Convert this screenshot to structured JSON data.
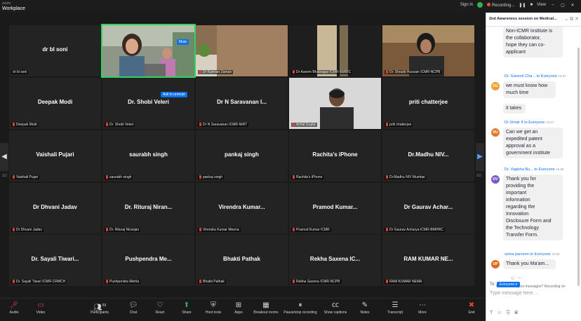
{
  "titlebar": {
    "brand_small": "zoom",
    "brand_big": "Workplace",
    "signin": "Sign in",
    "recording": "Recording...",
    "view": "View",
    "pause_icon": "pause-icon",
    "stop_icon": "stop-icon",
    "minimize_icon": "minimize-icon",
    "maximize_icon": "maximize-icon",
    "close_icon": "close-icon"
  },
  "meeting": {
    "mute_label": "Mute",
    "ask_unmute": "Ask to unmute",
    "page_left": "1/2",
    "page_right": "1/2",
    "tiles": [
      {
        "name": "dr bl soni",
        "label": "dr bl soni",
        "video": false
      },
      {
        "name": "",
        "label": "",
        "video": true
      },
      {
        "name": "",
        "label": "Dr Kamran Zaman",
        "video": true
      },
      {
        "name": "",
        "label": "Dr Aseem Bhatnagar ICMR-BMIRC",
        "video": true
      },
      {
        "name": "",
        "label": "Dr. Shoaib Hussain ICMR-NCPB",
        "video": true
      },
      {
        "name": "Deepak Modi",
        "label": "Deepak Modi",
        "video": false
      },
      {
        "name": "Dr. Shobi Veleri",
        "label": "Dr. Shobi Veleri",
        "video": false
      },
      {
        "name": "Dr N Saravanan I...",
        "label": "Dr N Saravanan ICMR-NIRT",
        "video": false
      },
      {
        "name": "",
        "label": "Achal Gupta",
        "video": true
      },
      {
        "name": "priti chatterjee",
        "label": "priti chatterjee",
        "video": false
      },
      {
        "name": "Vaishali Pujari",
        "label": "Vaishali Pujari",
        "video": false
      },
      {
        "name": "saurabh singh",
        "label": "saurabh singh",
        "video": false
      },
      {
        "name": "pankaj singh",
        "label": "pankaj singh",
        "video": false
      },
      {
        "name": "Rachita's iPhone",
        "label": "Rachita's iPhone",
        "video": false
      },
      {
        "name": "Dr.Madhu NIV...",
        "label": "Dr.Madhu NIV Mumbai",
        "video": false
      },
      {
        "name": "Dr Dhvani Jadav",
        "label": "Dr Dhvani Jadav",
        "video": false
      },
      {
        "name": "Dr. Rituraj Niran...",
        "label": "Dr. Rituraj Niranjan",
        "video": false
      },
      {
        "name": "Virendra Kumar...",
        "label": "Virendra Kumar Meena",
        "video": false
      },
      {
        "name": "Pramod Kumar...",
        "label": "Pramod Kumar ICMR",
        "video": false
      },
      {
        "name": "Dr Gaurav Achar...",
        "label": "Dr Gaurav Acharya ICMR-BMHRC",
        "video": false
      },
      {
        "name": "Dr. Sayali Tiwari...",
        "label": "Dr. Sayali Tiwari ICMR-CRMCH",
        "video": false
      },
      {
        "name": "Pushpendra Me...",
        "label": "Pushpendra Mehta",
        "video": false
      },
      {
        "name": "Bhakti Pathak",
        "label": "Bhakti Pathak",
        "video": false
      },
      {
        "name": "Rekha Saxena IC...",
        "label": "Rekha Saxena ICMR-NCPB",
        "video": false
      },
      {
        "name": "RAM KUMAR NE...",
        "label": "RAM KUMAR NEMA",
        "video": false
      }
    ]
  },
  "toolbar": {
    "audio": "Audio",
    "video": "Video",
    "participants": "Participants",
    "participants_count": "59",
    "chat": "Chat",
    "react": "React",
    "share": "Share",
    "host_tools": "Host tools",
    "apps": "Apps",
    "breakout": "Breakout rooms",
    "pause_stop": "Pause/stop recording",
    "captions": "Show captions",
    "notes": "Notes",
    "transcript": "Transcript",
    "more": "More",
    "end": "End"
  },
  "chat": {
    "title": "2nd Awareness session on Medical...",
    "messages": [
      {
        "text_lines": [
          "Non-ICMR institute is",
          "the collaborator,",
          "hope they can co-",
          "applicant"
        ]
      },
      {
        "sender": "Dr. Ganesh Cha...",
        "to": "to Everyone",
        "time": "15:57",
        "initials": "DG",
        "color": "#f0a030",
        "text_lines": [
          "we must know how",
          "much time"
        ]
      },
      {
        "text_lines": [
          "it takes"
        ]
      },
      {
        "sender": "Dr Umair II",
        "to": "to Everyone",
        "time": "15:57",
        "initials": "DU",
        "color": "#e07a30",
        "text_lines": [
          "Can we get an",
          "expedited patent",
          "approval as a",
          "government institute"
        ]
      },
      {
        "sender": "Dr. Vagisha Bu...",
        "to": "to Everyone",
        "time": "15:58",
        "initials": "DV",
        "color": "#7a5cc8",
        "text_lines": [
          "Thank you for",
          "providing the",
          "important",
          "information",
          "regarding the",
          "Innovation",
          "Disclosure Form and",
          "the Technology",
          "Transfer Form."
        ]
      },
      {
        "sender": "uzma parveen",
        "to": "to Everyone",
        "time": "15:58",
        "initials": "UP",
        "color": "#e06a20",
        "text_lines": [
          "Thank you Ma'am..."
        ]
      }
    ],
    "who_can_see": "Who can see your messages? Recording on",
    "to_label": "To:",
    "to_value": "Everyone",
    "placeholder": "Type message here..."
  }
}
